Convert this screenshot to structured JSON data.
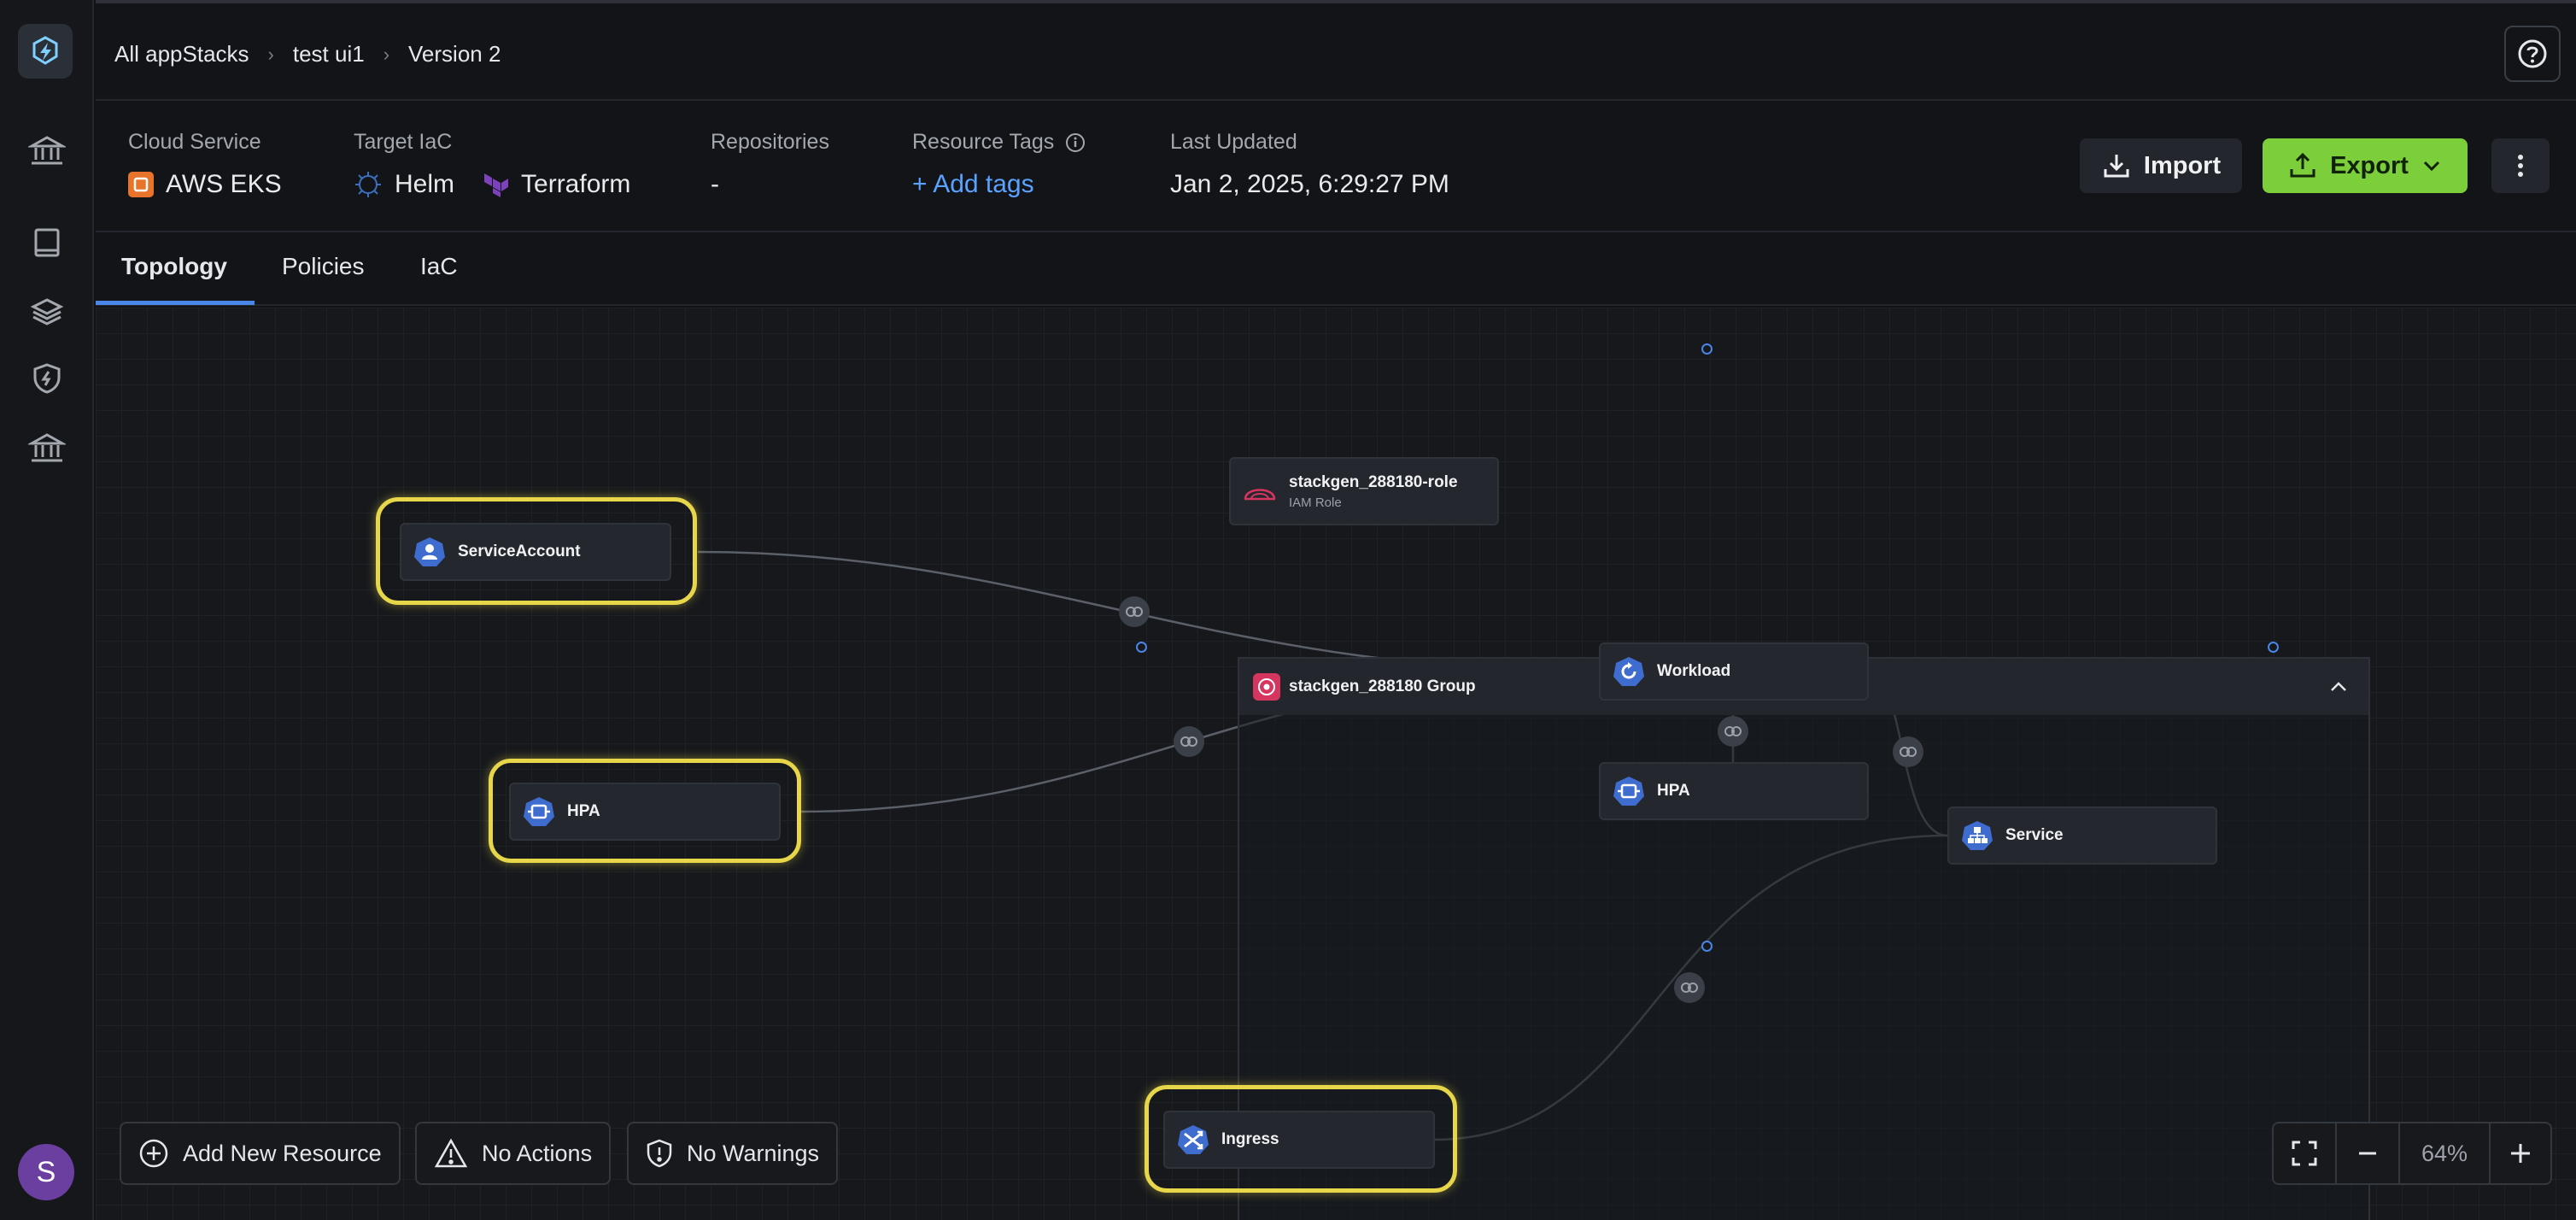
{
  "breadcrumbs": [
    "All appStacks",
    "test ui1",
    "Version 2"
  ],
  "info": {
    "cloud_service_label": "Cloud Service",
    "cloud_service_value": "AWS EKS",
    "target_iac_label": "Target IaC",
    "target_iac_values": [
      "Helm",
      "Terraform"
    ],
    "repositories_label": "Repositories",
    "repositories_value": "-",
    "resource_tags_label": "Resource Tags",
    "add_tags_label": "+ Add tags",
    "last_updated_label": "Last Updated",
    "last_updated_value": "Jan 2, 2025, 6:29:27 PM"
  },
  "actions": {
    "import_label": "Import",
    "export_label": "Export"
  },
  "tabs": [
    "Topology",
    "Policies",
    "IaC"
  ],
  "group": {
    "title": "stackgen_288180 Group"
  },
  "nodes": {
    "service_account": "ServiceAccount",
    "hpa_outer": "HPA",
    "iam_role": "stackgen_288180-role",
    "iam_role_sub": "IAM Role",
    "workload": "Workload",
    "hpa_inner": "HPA",
    "service": "Service",
    "ingress": "Ingress"
  },
  "bottom": {
    "add_resource": "Add New Resource",
    "no_actions": "No Actions",
    "no_warnings": "No Warnings",
    "zoom_level": "64%"
  },
  "user": {
    "avatar_letter": "S"
  },
  "colors": {
    "accent": "#4a86e8",
    "export": "#7ccf3a",
    "highlight": "#e7d54a",
    "aws": "#e8742c",
    "terraform": "#7b42bc"
  }
}
